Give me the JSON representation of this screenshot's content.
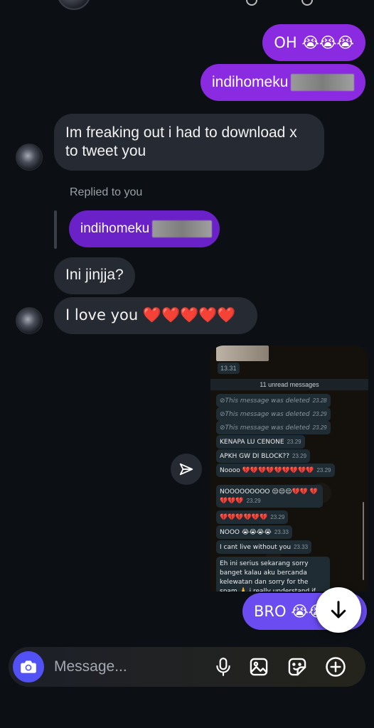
{
  "colors": {
    "outgoing_bubble": "#8a2be2",
    "incoming_bubble": "#262a32",
    "reply_bubble": "#6b21c8",
    "bro_bubble": "#6b4cf0",
    "camera_button": "#5151f5",
    "background": "#0c0f14"
  },
  "messages": {
    "out1": "OH 😭😭😭",
    "out2": "indihomeku",
    "in1": "Im freaking out i had to download x to tweet you",
    "replied_label": "Replied to you",
    "reply_quote": "indihomeku",
    "in2": "Ini jinjja?",
    "in3": "I love you ❤️❤️❤️❤️❤️",
    "bro": "BRO 😭😭"
  },
  "screenshot": {
    "top_time": "13.31",
    "unread": "11 unread messages",
    "items": [
      {
        "text": "This message was deleted",
        "time": "23.28",
        "deleted": true
      },
      {
        "text": "This message was deleted",
        "time": "23.29",
        "deleted": true
      },
      {
        "text": "This message was deleted",
        "time": "23.29",
        "deleted": true
      },
      {
        "text": "KENAPA LU CENONE",
        "time": "23.29",
        "deleted": false
      },
      {
        "text": "APKH GW DI BLOCK??",
        "time": "23.29",
        "deleted": false
      },
      {
        "text": "Noooo 💔💔💔💔💔💔💔💔💔",
        "time": "23.29",
        "deleted": false
      },
      {
        "text": "NOOOOOOOOO 😔😔😔💔💔 💔💔💔💔",
        "time": "23.29",
        "deleted": false
      },
      {
        "text": "💔💔💔💔💔💔",
        "time": "23.29",
        "deleted": false
      },
      {
        "text": "NOOO 😭😭😭😭",
        "time": "23.33",
        "deleted": false
      },
      {
        "text": "I cant live without you",
        "time": "23.33",
        "deleted": false
      },
      {
        "text": "Eh ini serius sekarang sorry banget kalau aku bercanda kelewatan dan sorry for the spam 🙏 i really understand if you choose that way",
        "time": "",
        "deleted": false
      }
    ]
  },
  "composer": {
    "placeholder": "Message...",
    "icons": [
      "camera-icon",
      "microphone-icon",
      "image-icon",
      "sticker-icon",
      "plus-circle-icon"
    ]
  }
}
